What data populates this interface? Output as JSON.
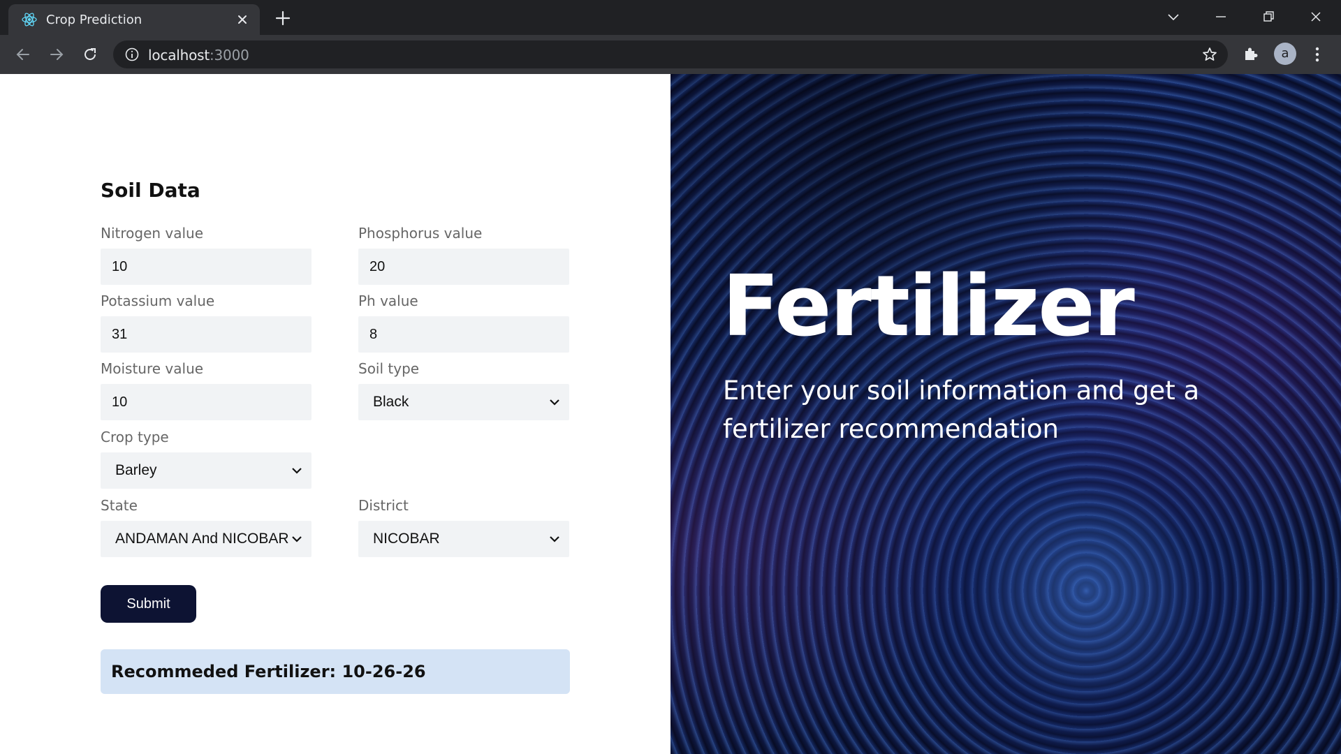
{
  "browser": {
    "tab_title": "Crop Prediction",
    "url_host": "localhost",
    "url_port": ":3000",
    "profile_initial": "a"
  },
  "form": {
    "title": "Soil Data",
    "nitrogen": {
      "label": "Nitrogen value",
      "value": "10"
    },
    "phosphorus": {
      "label": "Phosphorus value",
      "value": "20"
    },
    "potassium": {
      "label": "Potassium value",
      "value": "31"
    },
    "ph": {
      "label": "Ph value",
      "value": "8"
    },
    "moisture": {
      "label": "Moisture value",
      "value": "10"
    },
    "soil_type": {
      "label": "Soil type",
      "value": "Black"
    },
    "crop_type": {
      "label": "Crop type",
      "value": "Barley"
    },
    "state": {
      "label": "State",
      "value": "ANDAMAN And NICOBAR"
    },
    "district": {
      "label": "District",
      "value": "NICOBAR"
    },
    "submit_label": "Submit"
  },
  "result": {
    "text": "Recommeded Fertilizer: 10-26-26"
  },
  "hero": {
    "title": "Fertilizer",
    "subtitle": "Enter your soil information and get a fertilizer recommendation"
  },
  "colors": {
    "button_bg": "#0d1333",
    "result_bg": "#d4e3f5",
    "input_bg": "#f1f3f5"
  }
}
